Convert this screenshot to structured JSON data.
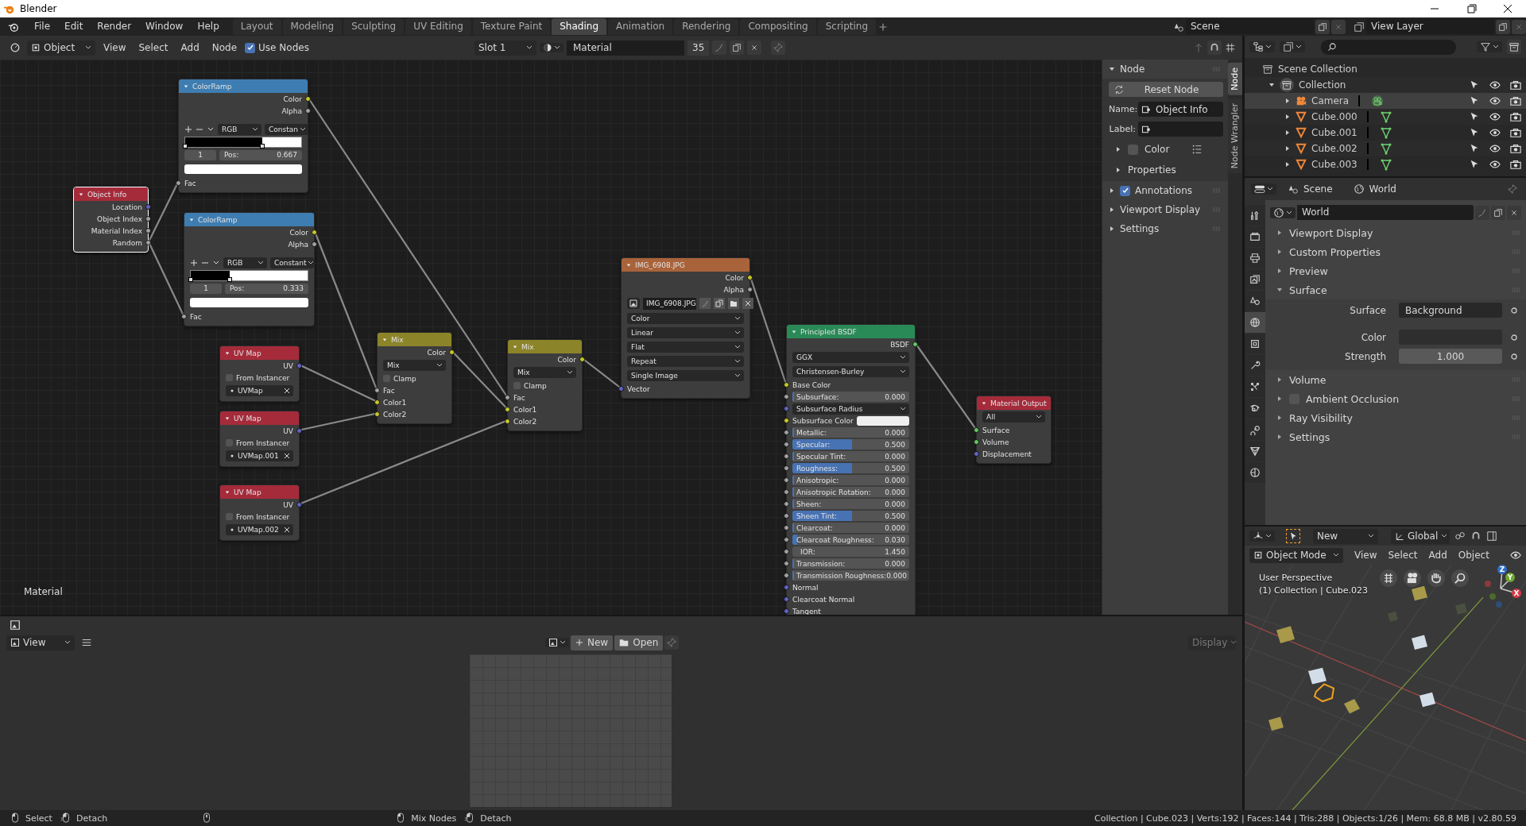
{
  "app_title": "Blender",
  "menus": [
    "File",
    "Edit",
    "Render",
    "Window",
    "Help"
  ],
  "workspaces": [
    {
      "label": "Layout",
      "selected": false
    },
    {
      "label": "Modeling",
      "selected": false
    },
    {
      "label": "Sculpting",
      "selected": false
    },
    {
      "label": "UV Editing",
      "selected": false
    },
    {
      "label": "Texture Paint",
      "selected": false
    },
    {
      "label": "Shading",
      "selected": true
    },
    {
      "label": "Animation",
      "selected": false
    },
    {
      "label": "Rendering",
      "selected": false
    },
    {
      "label": "Compositing",
      "selected": false
    },
    {
      "label": "Scripting",
      "selected": false
    }
  ],
  "scene": "Scene",
  "view_layer": "View Layer",
  "node_editor": {
    "header": {
      "mode": "Object",
      "menus": [
        "View",
        "Select",
        "Add",
        "Node"
      ],
      "use_nodes": {
        "label": "Use Nodes",
        "checked": true
      },
      "slot": "Slot 1",
      "material": "Material",
      "users": "35"
    },
    "canvas_label": "Material",
    "nodes": [
      {
        "title": "Object Info",
        "color": "#a52b3b",
        "selected": true,
        "rows": [
          {
            "kind": "output",
            "label": "Location",
            "color": "#6363c7"
          },
          {
            "kind": "output",
            "label": "Object Index",
            "color": "#a1a1a1"
          },
          {
            "kind": "output",
            "label": "Material Index",
            "color": "#a1a1a1"
          },
          {
            "kind": "output",
            "label": "Random",
            "color": "#a1a1a1"
          }
        ]
      },
      {
        "title": "ColorRamp",
        "color": "#3e7db1",
        "selected": false,
        "rows": [
          {
            "kind": "output",
            "label": "Color",
            "color": "#c7c729"
          },
          {
            "kind": "output",
            "label": "Alpha",
            "color": "#a1a1a1"
          },
          {
            "kind": "ramp_tools",
            "values": [
              "RGB",
              "Constan"
            ]
          },
          {
            "kind": "ramp",
            "level": 0.667
          },
          {
            "kind": "ramp_fields",
            "index": "1",
            "label": "Pos:",
            "value": "0.667"
          },
          {
            "kind": "swatch"
          },
          {
            "kind": "input",
            "label": "Fac",
            "color": "#a1a1a1"
          }
        ]
      },
      {
        "title": "ColorRamp",
        "color": "#3e7db1",
        "selected": false,
        "rows": [
          {
            "kind": "output",
            "label": "Color",
            "color": "#c7c729"
          },
          {
            "kind": "output",
            "label": "Alpha",
            "color": "#a1a1a1"
          },
          {
            "kind": "ramp_tools",
            "values": [
              "RGB",
              "Constant"
            ]
          },
          {
            "kind": "ramp",
            "level": 0.333
          },
          {
            "kind": "ramp_fields",
            "index": "1",
            "label": "Pos:",
            "value": "0.333"
          },
          {
            "kind": "swatch"
          },
          {
            "kind": "input",
            "label": "Fac",
            "color": "#a1a1a1"
          }
        ]
      },
      {
        "title": "UV Map",
        "color": "#a52b3b",
        "selected": false,
        "rows": [
          {
            "kind": "output",
            "label": "UV",
            "color": "#6363c7"
          },
          {
            "kind": "checkbox",
            "label": "From Instancer",
            "checked": false
          },
          {
            "kind": "field",
            "value": "UVMap"
          }
        ]
      },
      {
        "title": "UV Map",
        "color": "#a52b3b",
        "selected": false,
        "rows": [
          {
            "kind": "output",
            "label": "UV",
            "color": "#6363c7"
          },
          {
            "kind": "checkbox",
            "label": "From Instancer",
            "checked": false
          },
          {
            "kind": "field",
            "value": "UVMap.001"
          }
        ]
      },
      {
        "title": "UV Map",
        "color": "#a52b3b",
        "selected": false,
        "rows": [
          {
            "kind": "output",
            "label": "UV",
            "color": "#6363c7"
          },
          {
            "kind": "checkbox",
            "label": "From Instancer",
            "checked": false
          },
          {
            "kind": "field",
            "value": "UVMap.002"
          }
        ]
      },
      {
        "title": "Mix",
        "color": "#8c8429",
        "selected": false,
        "rows": [
          {
            "kind": "output",
            "label": "Color",
            "color": "#c7c729"
          },
          {
            "kind": "dropdown",
            "value": "Mix"
          },
          {
            "kind": "checkbox",
            "label": "Clamp",
            "checked": false
          },
          {
            "kind": "input",
            "label": "Fac",
            "color": "#a1a1a1"
          },
          {
            "kind": "input",
            "label": "Color1",
            "color": "#c7c729"
          },
          {
            "kind": "input",
            "label": "Color2",
            "color": "#c7c729"
          }
        ]
      },
      {
        "title": "Mix",
        "color": "#8c8429",
        "selected": false,
        "rows": [
          {
            "kind": "output",
            "label": "Color",
            "color": "#c7c729"
          },
          {
            "kind": "dropdown",
            "value": "Mix"
          },
          {
            "kind": "checkbox",
            "label": "Clamp",
            "checked": false
          },
          {
            "kind": "input",
            "label": "Fac",
            "color": "#a1a1a1"
          },
          {
            "kind": "input",
            "label": "Color1",
            "color": "#c7c729"
          },
          {
            "kind": "input",
            "label": "Color2",
            "color": "#c7c729"
          }
        ]
      },
      {
        "title": "IMG_6908.JPG",
        "color": "#a9633a",
        "selected": false,
        "rows": [
          {
            "kind": "output",
            "label": "Color",
            "color": "#c7c729"
          },
          {
            "kind": "output",
            "label": "Alpha",
            "color": "#a1a1a1"
          },
          {
            "kind": "image",
            "value": "IMG_6908.JPG"
          },
          {
            "kind": "dropdown",
            "value": "Color"
          },
          {
            "kind": "dropdown",
            "value": "Linear"
          },
          {
            "kind": "dropdown",
            "value": "Flat"
          },
          {
            "kind": "dropdown",
            "value": "Repeat"
          },
          {
            "kind": "dropdown",
            "value": "Single Image"
          },
          {
            "kind": "input",
            "label": "Vector",
            "color": "#6363c7"
          }
        ]
      },
      {
        "title": "Principled BSDF",
        "color": "#2a8a57",
        "selected": false,
        "rows": [
          {
            "kind": "output",
            "label": "BSDF",
            "color": "#63c763"
          },
          {
            "kind": "dropdown",
            "value": "GGX"
          },
          {
            "kind": "dropdown",
            "value": "Christensen-Burley"
          },
          {
            "kind": "input",
            "label": "Base Color",
            "color": "#c7c729"
          },
          {
            "kind": "slider",
            "label": "Subsurface:",
            "value": "0.000",
            "level": 0,
            "color": "#a1a1a1"
          },
          {
            "kind": "select_input",
            "value": "Subsurface Radius",
            "color": "#6363c7"
          },
          {
            "kind": "color_input",
            "label": "Subsurface Color",
            "color": "#c7c729"
          },
          {
            "kind": "slider",
            "label": "Metallic:",
            "value": "0.000",
            "level": 0,
            "color": "#a1a1a1"
          },
          {
            "kind": "slider",
            "label": "Specular:",
            "value": "0.500",
            "level": 0.5,
            "color": "#a1a1a1"
          },
          {
            "kind": "slider",
            "label": "Specular Tint:",
            "value": "0.000",
            "level": 0,
            "color": "#a1a1a1"
          },
          {
            "kind": "slider",
            "label": "Roughness:",
            "value": "0.500",
            "level": 0.5,
            "color": "#a1a1a1"
          },
          {
            "kind": "slider",
            "label": "Anisotropic:",
            "value": "0.000",
            "level": 0,
            "color": "#a1a1a1"
          },
          {
            "kind": "slider",
            "label": "Anisotropic Rotation:",
            "value": "0.000",
            "level": 0,
            "color": "#a1a1a1"
          },
          {
            "kind": "slider",
            "label": "Sheen:",
            "value": "0.000",
            "level": 0,
            "color": "#a1a1a1"
          },
          {
            "kind": "slider",
            "label": "Sheen Tint:",
            "value": "0.500",
            "level": 0.5,
            "color": "#a1a1a1"
          },
          {
            "kind": "slider",
            "label": "Clearcoat:",
            "value": "0.000",
            "level": 0,
            "color": "#a1a1a1"
          },
          {
            "kind": "slider",
            "label": "Clearcoat Roughness:",
            "value": "0.030",
            "level": 0.03,
            "color": "#a1a1a1"
          },
          {
            "kind": "number",
            "label": "IOR:",
            "value": "1.450",
            "color": "#a1a1a1"
          },
          {
            "kind": "slider",
            "label": "Transmission:",
            "value": "0.000",
            "level": 0,
            "color": "#a1a1a1"
          },
          {
            "kind": "slider",
            "label": "Transmission Roughness:",
            "value": "0.000",
            "level": 0,
            "color": "#a1a1a1"
          },
          {
            "kind": "input",
            "label": "Normal",
            "color": "#6363c7"
          },
          {
            "kind": "input",
            "label": "Clearcoat Normal",
            "color": "#6363c7"
          },
          {
            "kind": "input",
            "label": "Tangent",
            "color": "#6363c7"
          }
        ]
      },
      {
        "title": "Material Output",
        "color": "#a52b3b",
        "selected": false,
        "rows": [
          {
            "kind": "dropdown",
            "value": "All"
          },
          {
            "kind": "input",
            "label": "Surface",
            "color": "#63c763"
          },
          {
            "kind": "input",
            "label": "Volume",
            "color": "#63c763"
          },
          {
            "kind": "input",
            "label": "Displacement",
            "color": "#6363c7"
          }
        ]
      }
    ]
  },
  "n_panel": {
    "tabs": [
      {
        "label": "Node",
        "selected": true
      },
      {
        "label": "Node Wrangler",
        "selected": false
      }
    ],
    "title": "Node",
    "reset": "Reset Node",
    "name_label": "Name:",
    "name": "Object Info",
    "label_label": "Label:",
    "color": {
      "label": "Color",
      "checked": false
    },
    "properties": "Properties",
    "panels": [
      {
        "kind": "checkbox",
        "label": "Annotations",
        "checked": true
      },
      {
        "kind": "plain",
        "label": "Viewport Display"
      },
      {
        "kind": "plain",
        "label": "Settings"
      }
    ]
  },
  "outliner": {
    "root": "Scene Collection",
    "items": [
      {
        "label": "Collection",
        "kind": "collection",
        "expanded": true,
        "selected": false,
        "children": [
          {
            "label": "Camera",
            "kind": "camera",
            "expanded": false,
            "selected": true
          },
          {
            "label": "Cube.000",
            "kind": "mesh",
            "expanded": false,
            "selected": false
          },
          {
            "label": "Cube.001",
            "kind": "mesh",
            "expanded": false,
            "selected": false
          },
          {
            "label": "Cube.002",
            "kind": "mesh",
            "expanded": false,
            "selected": false
          },
          {
            "label": "Cube.003",
            "kind": "mesh",
            "expanded": false,
            "selected": false
          }
        ]
      }
    ]
  },
  "properties": {
    "breadcrumb": [
      "Scene",
      "World"
    ],
    "tabs": [
      {
        "kind": "tool",
        "selected": false
      },
      {
        "kind": "render",
        "selected": false
      },
      {
        "kind": "output",
        "selected": false
      },
      {
        "kind": "view_layer",
        "selected": false
      },
      {
        "kind": "scene",
        "selected": false
      },
      {
        "kind": "world",
        "selected": true
      },
      {
        "kind": "object",
        "selected": false
      },
      {
        "kind": "modifier",
        "selected": false
      },
      {
        "kind": "particles",
        "selected": false
      },
      {
        "kind": "physics",
        "selected": false
      },
      {
        "kind": "constraints",
        "selected": false
      },
      {
        "kind": "data",
        "selected": false
      },
      {
        "kind": "material",
        "selected": false
      }
    ],
    "world": "World",
    "panels": [
      {
        "label": "Viewport Display",
        "expanded": false
      },
      {
        "label": "Custom Properties",
        "expanded": false
      },
      {
        "label": "Preview",
        "expanded": false
      },
      {
        "label": "Surface",
        "expanded": true,
        "fields": [
          {
            "kind": "dropdown",
            "label": "Surface",
            "value": "Background"
          },
          {
            "kind": "color",
            "label": "Color"
          },
          {
            "kind": "number",
            "label": "Strength",
            "value": "1.000"
          }
        ]
      },
      {
        "label": "Volume",
        "expanded": false
      },
      {
        "label": "Ambient Occlusion",
        "expanded": false,
        "checked": false
      },
      {
        "label": "Ray Visibility",
        "expanded": false
      },
      {
        "label": "Settings",
        "expanded": false
      }
    ]
  },
  "viewport": {
    "new": "New",
    "orientation": "Global",
    "mode": "Object Mode",
    "menus": [
      "View",
      "Select",
      "Add",
      "Object"
    ],
    "overlay": [
      "User Perspective",
      "(1) Collection | Cube.023"
    ],
    "axes": [
      "X",
      "Y",
      "Z"
    ]
  },
  "image_editor": {
    "view": "View",
    "new": "New",
    "open": "Open",
    "display": "Display"
  },
  "status": {
    "items": [
      {
        "kind": "left",
        "label": "Select"
      },
      {
        "kind": "drag",
        "label": "Detach"
      },
      {
        "kind": "middle"
      },
      {
        "kind": "left",
        "label": "Mix Nodes"
      },
      {
        "kind": "drag",
        "label": "Detach"
      }
    ],
    "info": "Collection | Cube.023 | Verts:192 | Faces:144 | Tris:288 | Objects:1/26 | Mem: 68.8 MB | v2.80.59"
  }
}
